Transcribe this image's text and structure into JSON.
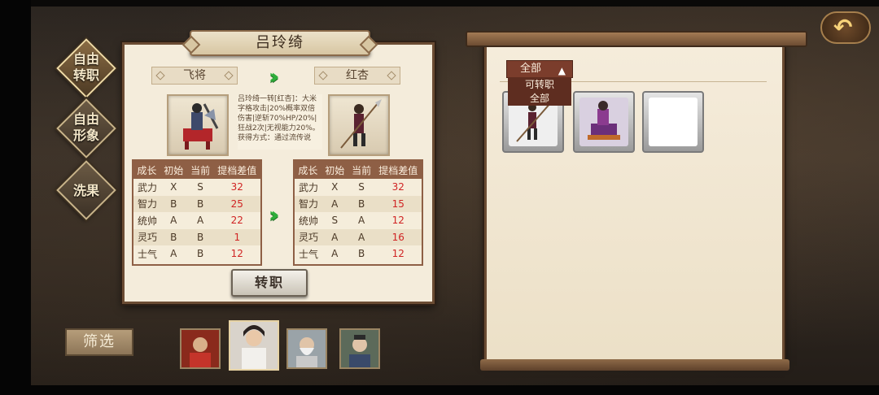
{
  "nav": {
    "items": [
      {
        "label_line1": "自由",
        "label_line2": "转职",
        "active": true
      },
      {
        "label_line1": "自由",
        "label_line2": "形象",
        "active": false
      },
      {
        "label_line1": "洗果",
        "label_line2": "",
        "active": false
      }
    ]
  },
  "panel": {
    "hero_name": "吕玲绮",
    "from_class": "飞将",
    "to_class": "红杏",
    "description": "吕玲绮一转[红杏]：大米字格攻击|20%概率双倍伤害|逆斩70%HP/20%|狂战2次|无视能力20%。获得方式：通过流传说",
    "convert_button": "转职"
  },
  "table_headers": [
    "成长",
    "初始",
    "当前",
    "提档差值"
  ],
  "left_stats": [
    {
      "name": "武力",
      "initial": "X",
      "current": "S",
      "diff": "32"
    },
    {
      "name": "智力",
      "initial": "B",
      "current": "B",
      "diff": "25"
    },
    {
      "name": "统帅",
      "initial": "A",
      "current": "A",
      "diff": "22"
    },
    {
      "name": "灵巧",
      "initial": "B",
      "current": "B",
      "diff": "1"
    },
    {
      "name": "士气",
      "initial": "A",
      "current": "B",
      "diff": "12"
    }
  ],
  "right_stats": [
    {
      "name": "武力",
      "initial": "X",
      "current": "S",
      "diff": "32"
    },
    {
      "name": "智力",
      "initial": "A",
      "current": "B",
      "diff": "15"
    },
    {
      "name": "统帅",
      "initial": "S",
      "current": "A",
      "diff": "12"
    },
    {
      "name": "灵巧",
      "initial": "A",
      "current": "A",
      "diff": "16"
    },
    {
      "name": "士气",
      "initial": "A",
      "current": "B",
      "diff": "12"
    }
  ],
  "filter_dropdown": {
    "selected": "全部",
    "options": [
      "可转职",
      "全部"
    ]
  },
  "bottom": {
    "filter_button": "筛选"
  },
  "icons": {
    "back": "back-arrow-icon",
    "chevron": "double-chevron-right-icon",
    "dropdown": "chevron-up-icon"
  },
  "colors": {
    "panel_bg": "#f4ecdb",
    "header_bg": "#8e5f45",
    "diff_red": "#d02323",
    "chevron_green": "#2fae3b"
  }
}
